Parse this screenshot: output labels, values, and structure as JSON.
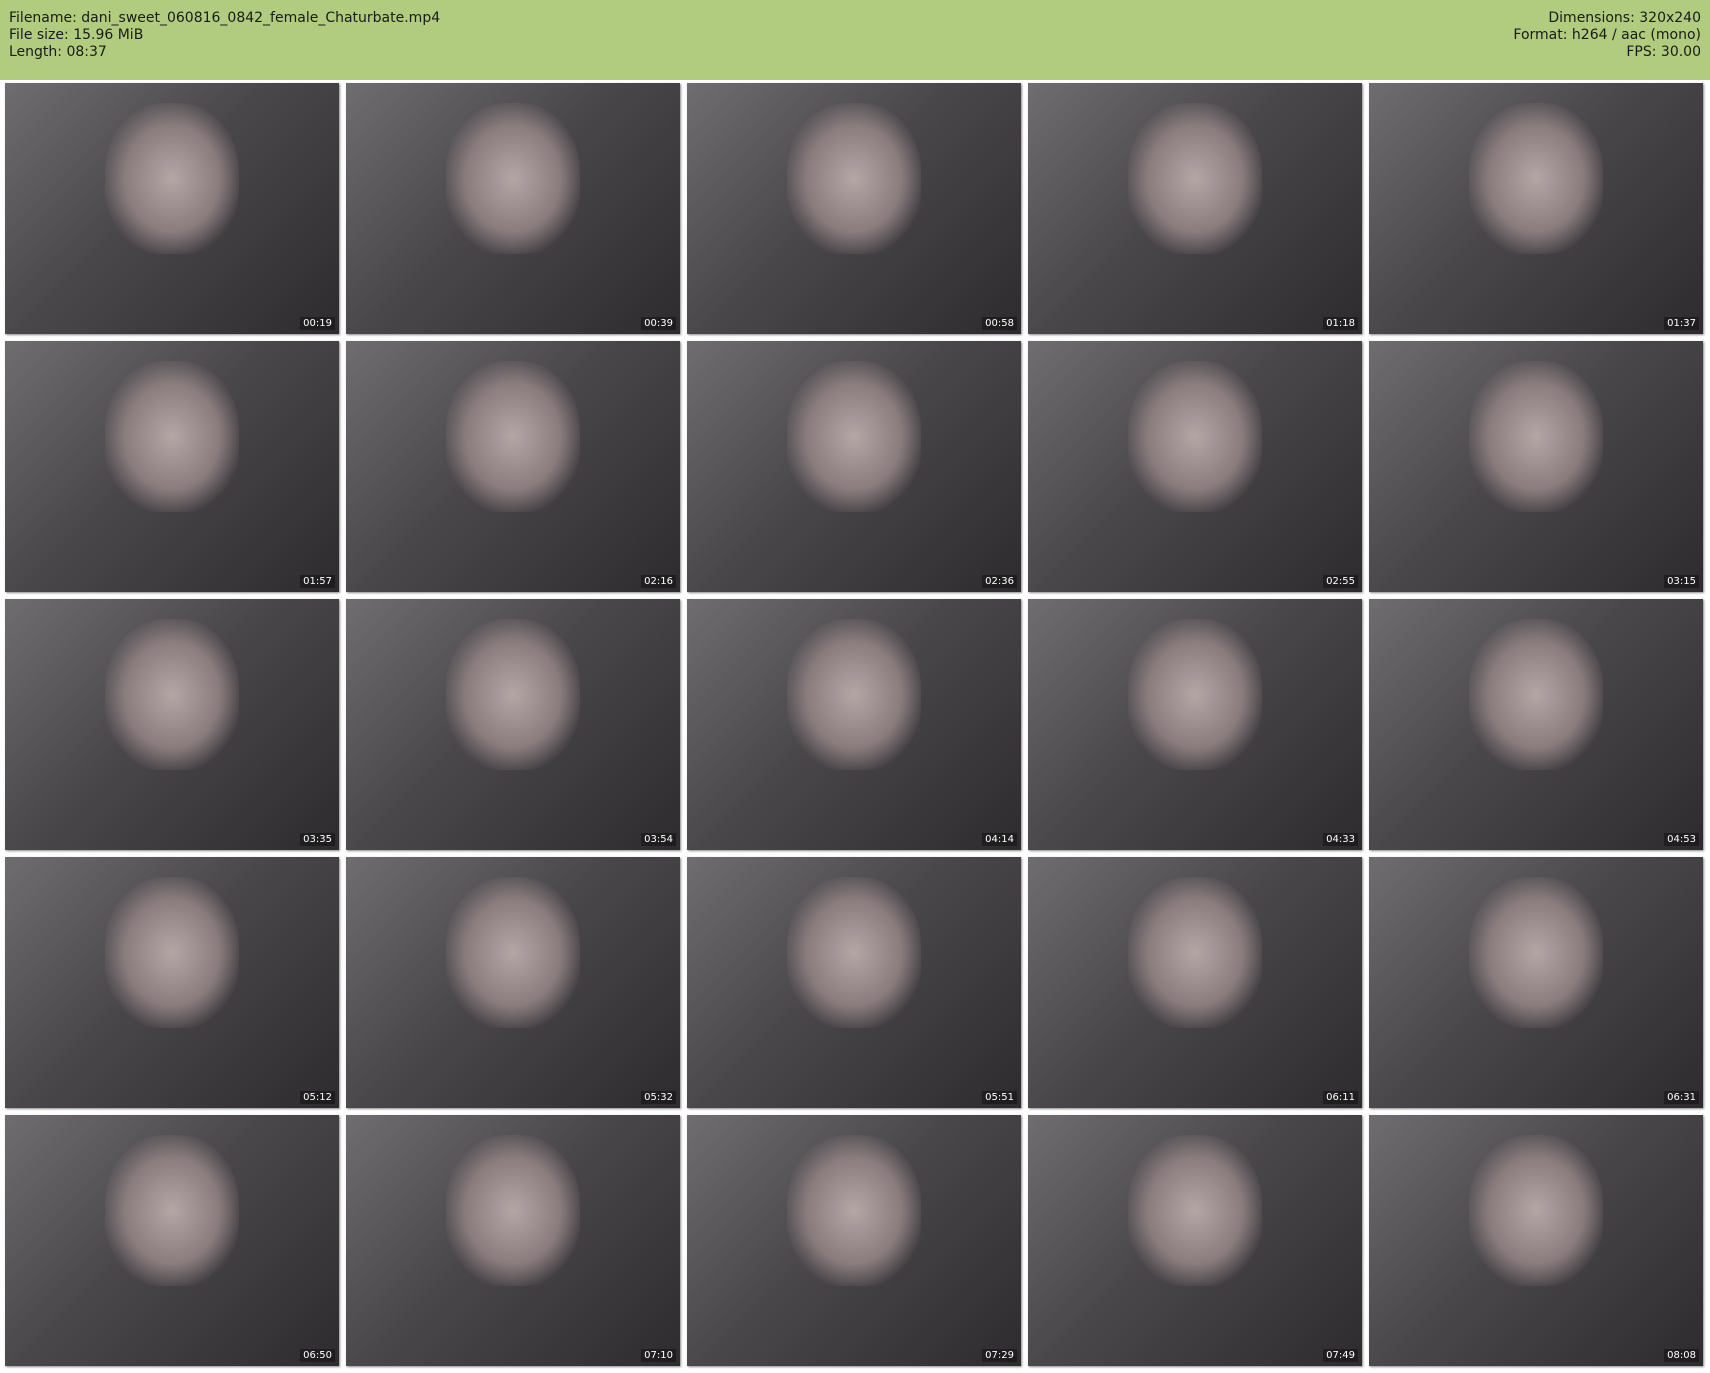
{
  "header": {
    "filename": "Filename: dani_sweet_060816_0842_female_Chaturbate.mp4",
    "filesize": "File size: 15.96 MiB",
    "length": "Length: 08:37",
    "dimensions": "Dimensions: 320x240",
    "format": "Format: h264 / aac (mono)",
    "fps": "FPS: 30.00"
  },
  "thumbnails": [
    "00:19",
    "00:39",
    "00:58",
    "01:18",
    "01:37",
    "01:57",
    "02:16",
    "02:36",
    "02:55",
    "03:15",
    "03:35",
    "03:54",
    "04:14",
    "04:33",
    "04:53",
    "05:12",
    "05:32",
    "05:51",
    "06:11",
    "06:31",
    "06:50",
    "07:10",
    "07:29",
    "07:49",
    "08:08"
  ]
}
